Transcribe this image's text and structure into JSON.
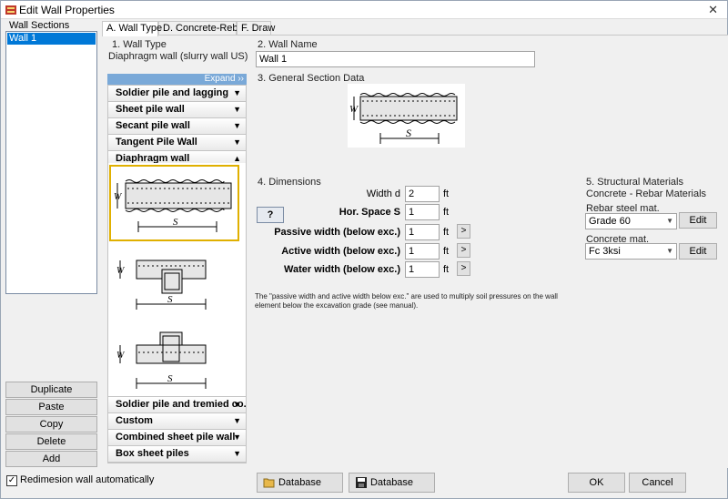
{
  "window": {
    "title": "Edit Wall Properties",
    "close_glyph": "✕"
  },
  "left": {
    "label": "Wall Sections",
    "items": [
      "Wall 1"
    ],
    "buttons": {
      "duplicate": "Duplicate",
      "paste": "Paste",
      "copy": "Copy",
      "delete": "Delete",
      "add": "Add"
    },
    "redimension_label": "Redimesion wall automatically",
    "redimension_checked": true
  },
  "tabs": [
    "A. Wall Type",
    "D. Concrete-Rebar",
    "F. Draw"
  ],
  "wall_type": {
    "heading": "1. Wall Type",
    "current": "Diaphragm wall (slurry wall US)",
    "expand_label": "Expand ››",
    "groups": [
      "Soldier pile and lagging",
      "Sheet pile wall",
      "Secant pile wall",
      "Tangent Pile Wall",
      "Diaphragm wall"
    ],
    "groups_after": [
      "Soldier pile and tremied co...",
      "Custom",
      "Combined sheet pile wall",
      "Box sheet piles"
    ]
  },
  "wall_name": {
    "heading": "2. Wall Name",
    "value": "Wall 1"
  },
  "general": {
    "heading": "3. General Section Data",
    "dim_w": "W",
    "dim_s": "S"
  },
  "dimensions": {
    "heading": "4. Dimensions",
    "help_label": "?",
    "rows": [
      {
        "label": "Width d",
        "value": "2",
        "unit": "ft",
        "bold": false
      },
      {
        "label": "Hor. Space S",
        "value": "1",
        "unit": "ft",
        "bold": true
      },
      {
        "label": "Passive width (below exc.)",
        "value": "1",
        "unit": "ft",
        "bold": true
      },
      {
        "label": "Active width (below exc.)",
        "value": "1",
        "unit": "ft",
        "bold": true
      },
      {
        "label": "Water width (below exc.)",
        "value": "1",
        "unit": "ft",
        "bold": true
      }
    ],
    "arrow_label": ">",
    "note": "The \"passive width and active width below exc.\" are used to multiply soil pressures on the wall element below the excavation grade (see manual)."
  },
  "materials": {
    "heading": "5. Structural Materials",
    "subheading": "Concrete - Rebar Materials",
    "rebar_label": "Rebar steel mat.",
    "rebar_value": "Grade 60",
    "concrete_label": "Concrete mat.",
    "concrete_value": "Fc 3ksi",
    "edit_label": "Edit"
  },
  "footer": {
    "database1": "Database",
    "database2": "Database",
    "ok": "OK",
    "cancel": "Cancel"
  },
  "colors": {
    "accent": "#0078d7",
    "expand_bg": "#7aa9d8",
    "selected_border": "#e0b000"
  }
}
